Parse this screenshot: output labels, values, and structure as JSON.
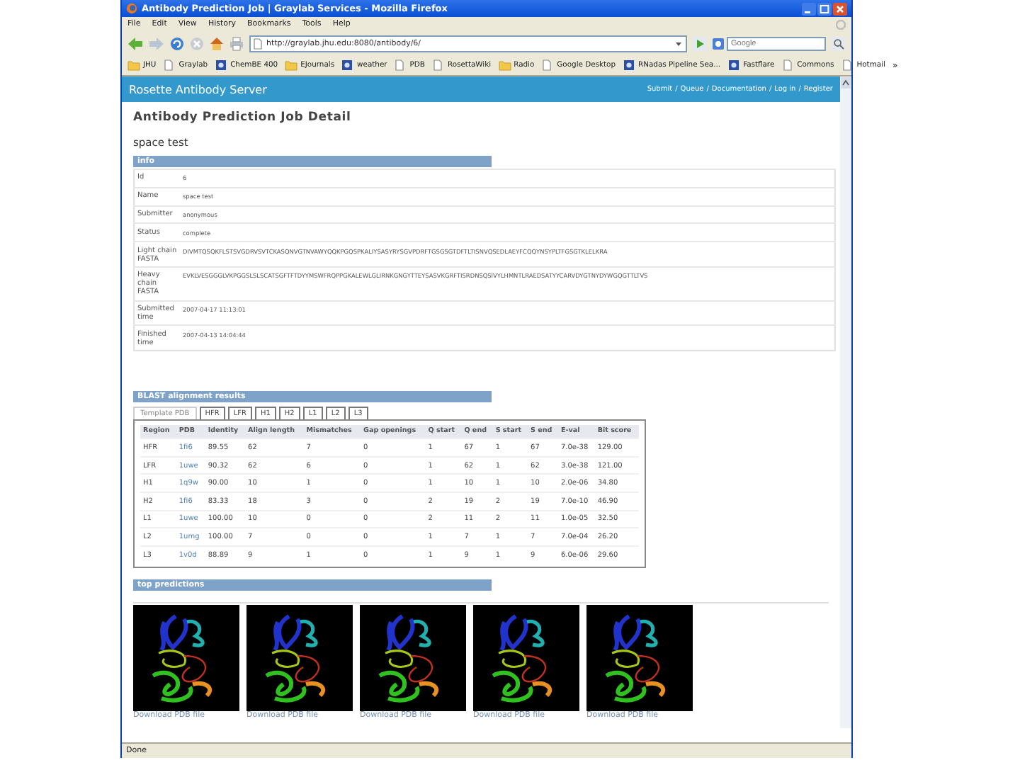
{
  "window": {
    "title": "Antibody Prediction Job | Graylab Services - Mozilla Firefox"
  },
  "menu": [
    "File",
    "Edit",
    "View",
    "History",
    "Bookmarks",
    "Tools",
    "Help"
  ],
  "address_bar": {
    "value": "http://graylab.jhu.edu:8080/antibody/6/"
  },
  "search": {
    "placeholder": "Google"
  },
  "bookmarks": [
    {
      "kind": "folder",
      "label": "JHU"
    },
    {
      "kind": "page",
      "label": "Graylab"
    },
    {
      "kind": "site",
      "label": "ChemBE 400"
    },
    {
      "kind": "folder",
      "label": "EJournals"
    },
    {
      "kind": "site",
      "label": "weather"
    },
    {
      "kind": "page",
      "label": "PDB"
    },
    {
      "kind": "page",
      "label": "RosettaWiki"
    },
    {
      "kind": "folder",
      "label": "Radio"
    },
    {
      "kind": "page",
      "label": "Google Desktop"
    },
    {
      "kind": "site",
      "label": "RNadas Pipeline Sea..."
    },
    {
      "kind": "site",
      "label": "Fastflare"
    },
    {
      "kind": "page",
      "label": "Commons"
    },
    {
      "kind": "page",
      "label": "Hotmail"
    }
  ],
  "bookmarks_overflow": "»",
  "site": {
    "name": "Rosette Antibody Server",
    "nav": [
      "Submit",
      "Queue",
      "Documentation",
      "Log in",
      "Register"
    ],
    "nav_separator": "/"
  },
  "heading": "Antibody Prediction Job Detail",
  "job_name": "space test",
  "info": {
    "title": "info",
    "rows": [
      {
        "label": "Id",
        "value": "6"
      },
      {
        "label": "Name",
        "value": "space test"
      },
      {
        "label": "Submitter",
        "value": "anonymous"
      },
      {
        "label": "Status",
        "value": "complete"
      },
      {
        "label": "Light chain FASTA",
        "value": "DIVMTQSQKFLSTSVGDRVSVTCKASQNVGTNVAWYQQKPGQSPKALIYSASYRYSGVPDRFTGSGSGTDFTLTISNVQSEDLAEYFCQQYNSYPLTFGSGTKLELKRA"
      },
      {
        "label": "Heavy chain FASTA",
        "value": "EVKLVESGGGLVKPGGSLSLSCATSGFTFTDYYMSWFRQPPGKALEWLGLIRNKGNGYTTEYSASVKGRFTISRDNSQSIVYLHMNTLRAEDSATYYCARVDYGTNYDYWGQGTTLTVS"
      },
      {
        "label": "Submitted time",
        "value": "2007-04-17 11:13:01"
      },
      {
        "label": "Finished time",
        "value": "2007-04-13 14:04:44"
      }
    ]
  },
  "blast": {
    "title": "BLAST alignment results",
    "tabs": [
      {
        "label": "Template PDB",
        "selected": true
      },
      {
        "label": "HFR",
        "selected": false
      },
      {
        "label": "LFR",
        "selected": false
      },
      {
        "label": "H1",
        "selected": false
      },
      {
        "label": "H2",
        "selected": false
      },
      {
        "label": "L1",
        "selected": false
      },
      {
        "label": "L2",
        "selected": false
      },
      {
        "label": "L3",
        "selected": false
      }
    ],
    "columns": [
      "Region",
      "PDB",
      "Identity",
      "Align length",
      "Mismatches",
      "Gap openings",
      "Q start",
      "Q end",
      "S start",
      "S end",
      "E-val",
      "Bit score"
    ],
    "rows": [
      [
        "HFR",
        "1fi6",
        "89.55",
        "62",
        "7",
        "0",
        "1",
        "67",
        "1",
        "67",
        "7.0e-38",
        "129.00"
      ],
      [
        "LFR",
        "1uwe",
        "90.32",
        "62",
        "6",
        "0",
        "1",
        "62",
        "1",
        "62",
        "3.0e-38",
        "121.00"
      ],
      [
        "H1",
        "1q9w",
        "90.00",
        "10",
        "1",
        "0",
        "1",
        "10",
        "1",
        "10",
        "2.0e-06",
        "34.80"
      ],
      [
        "H2",
        "1fi6",
        "83.33",
        "18",
        "3",
        "0",
        "2",
        "19",
        "2",
        "19",
        "7.0e-10",
        "46.90"
      ],
      [
        "L1",
        "1uwe",
        "100.00",
        "10",
        "0",
        "0",
        "2",
        "11",
        "2",
        "11",
        "1.0e-05",
        "32.50"
      ],
      [
        "L2",
        "1umg",
        "100.00",
        "7",
        "0",
        "0",
        "1",
        "7",
        "1",
        "7",
        "7.0e-04",
        "26.20"
      ],
      [
        "L3",
        "1v0d",
        "88.89",
        "9",
        "1",
        "0",
        "1",
        "9",
        "1",
        "9",
        "6.0e-06",
        "29.60"
      ]
    ]
  },
  "predictions": {
    "title": "top predictions",
    "items": [
      {
        "link": "Download PDB file"
      },
      {
        "link": "Download PDB file"
      },
      {
        "link": "Download PDB file"
      },
      {
        "link": "Download PDB file"
      },
      {
        "link": "Download PDB file"
      }
    ]
  },
  "status_bar": "Done"
}
